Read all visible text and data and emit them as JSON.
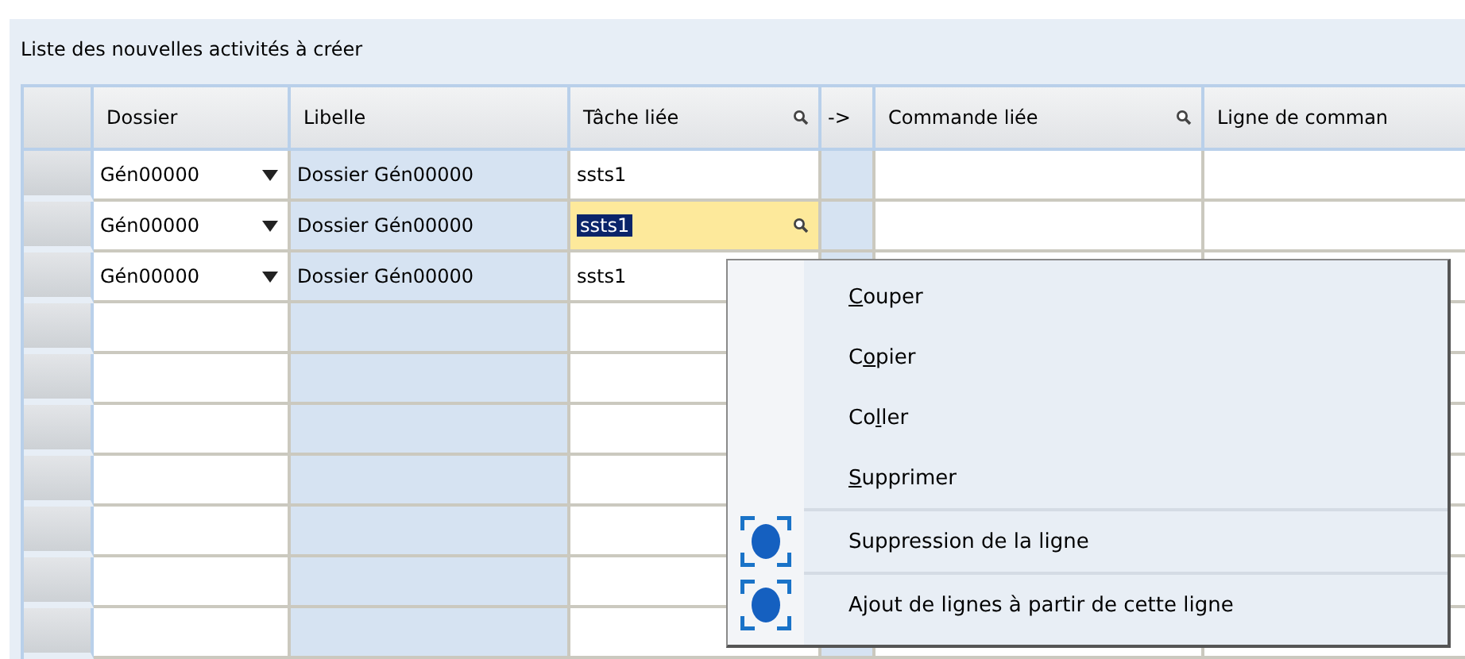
{
  "panel": {
    "title": "Liste des nouvelles activités à créer"
  },
  "table": {
    "columns": [
      {
        "label": "Dossier",
        "kind": "text"
      },
      {
        "label": "Libelle",
        "kind": "text"
      },
      {
        "label": "Tâche liée",
        "kind": "lookup"
      },
      {
        "label": "->",
        "kind": "link"
      },
      {
        "label": "Commande liée",
        "kind": "lookup"
      },
      {
        "label": "Ligne de comman",
        "kind": "text"
      }
    ],
    "rows": [
      {
        "dossier": "Gén00000",
        "libelle": "Dossier Gén00000",
        "tache": "ssts1",
        "editing": false
      },
      {
        "dossier": "Gén00000",
        "libelle": "Dossier Gén00000",
        "tache": "ssts1",
        "editing": true
      },
      {
        "dossier": "Gén00000",
        "libelle": "Dossier Gén00000",
        "tache": "ssts1",
        "editing": false
      },
      {
        "editing": false
      },
      {
        "editing": false
      },
      {
        "editing": false
      },
      {
        "editing": false
      },
      {
        "editing": false
      },
      {
        "editing": false
      },
      {
        "editing": false
      }
    ]
  },
  "context_menu": {
    "items": [
      {
        "label_parts": [
          {
            "text": "C",
            "underlined": true
          },
          {
            "text": "ouper",
            "underlined": false
          }
        ],
        "kind": "plain"
      },
      {
        "label_parts": [
          {
            "text": "C",
            "underlined": false
          },
          {
            "text": "o",
            "underlined": true
          },
          {
            "text": "pier",
            "underlined": false
          }
        ],
        "kind": "plain"
      },
      {
        "label_parts": [
          {
            "text": "Co",
            "underlined": false
          },
          {
            "text": "l",
            "underlined": true
          },
          {
            "text": "ler",
            "underlined": false
          }
        ],
        "kind": "plain"
      },
      {
        "label_parts": [
          {
            "text": "S",
            "underlined": true
          },
          {
            "text": "upprimer",
            "underlined": false
          }
        ],
        "kind": "plain"
      },
      {
        "label_parts": [
          {
            "text": "Suppression de la ligne",
            "underlined": false
          }
        ],
        "kind": "action"
      },
      {
        "label_parts": [
          {
            "text": "Ajout de lignes à partir de cette ligne",
            "underlined": false
          }
        ],
        "kind": "action"
      }
    ]
  }
}
